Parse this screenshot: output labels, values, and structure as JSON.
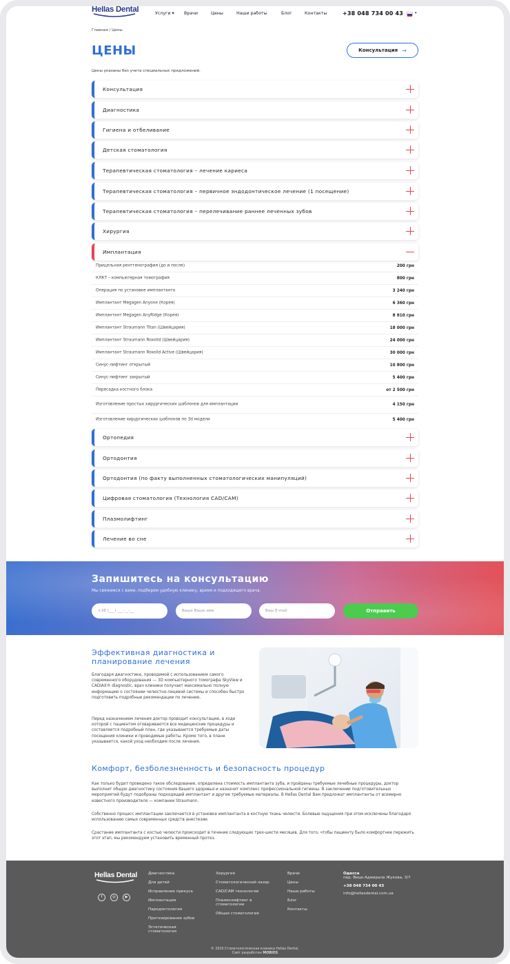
{
  "header": {
    "logo": "Hellas Dental",
    "nav": [
      {
        "label": "Услуги ▾"
      },
      {
        "label": "Врачи"
      },
      {
        "label": "Цены"
      },
      {
        "label": "Наши работы"
      },
      {
        "label": "Блог"
      },
      {
        "label": "Контакты"
      }
    ],
    "phone": "+38 048 734 00 43",
    "language": "RU"
  },
  "breadcrumb": "Главная  /  Цены",
  "page_title": "ЦЕНЫ",
  "consult_button": "Консультация",
  "note": "Цены указаны без учета специальных предложений.",
  "accordion": [
    {
      "label": "Консультация",
      "open": false
    },
    {
      "label": "Диагностика",
      "open": false
    },
    {
      "label": "Гигиена и отбеливание",
      "open": false
    },
    {
      "label": "Детская стоматология",
      "open": false
    },
    {
      "label": "Терапевтическая стоматология – лечение кариеса",
      "open": false
    },
    {
      "label": "Терапевтическая стоматология – первичное эндодонтическое лечение (1 посещение)",
      "open": false
    },
    {
      "label": "Терапевтическая стоматология – перелечивание раннее леченных зубов",
      "open": false
    },
    {
      "label": "Хирургия",
      "open": false
    },
    {
      "label": "Имплантация",
      "open": true
    },
    {
      "label": "Ортопедия",
      "open": false
    },
    {
      "label": "Ортодонтия",
      "open": false
    },
    {
      "label": "Ортодонтия (по факту выполненных стоматологических манипуляций)",
      "open": false
    },
    {
      "label": "Цифровая стоматология (Технология CAD/CAM)",
      "open": false
    },
    {
      "label": "Плазмолифтинг",
      "open": false
    },
    {
      "label": "Лечение во сне",
      "open": false
    }
  ],
  "implant_prices": [
    {
      "name": "Прицельная рентгенография (до и после)",
      "price": "200 грн"
    },
    {
      "name": "КЛКТ – компьютерная томография",
      "price": "800 грн"
    },
    {
      "name": "Операция по установке имплантанта",
      "price": "3 240 грн"
    },
    {
      "name": "Имплантант Megagen Anyone (Корея)",
      "price": "6 360 грн"
    },
    {
      "name": "Имплантант Megagen AnyRidge (Корея)",
      "price": "8 910 грн"
    },
    {
      "name": "Имплантант Straumann Titan (Швейцария)",
      "price": "18 000 грн"
    },
    {
      "name": "Имплантант Straumann Roxolid (Швейцария)",
      "price": "24 000 грн"
    },
    {
      "name": "Имплантант Straumann Roxolid Active (Швейцария)",
      "price": "30 000 грн"
    },
    {
      "name": "Синус-лифтинг открытый",
      "price": "10 800 грн"
    },
    {
      "name": "Синус-лифтинг закрытый",
      "price": "5 400 грн"
    },
    {
      "name": "Пересадка костного блока",
      "price": "от 2 500 грн"
    },
    {
      "name": "Изготовление простых хирургических шаблонов для имплантации",
      "price": "4 150 грн"
    },
    {
      "name": "Изготовление хирургических шаблонов по 3d модели",
      "price": "5 400 грн"
    }
  ],
  "form": {
    "title": "Запишитесь на консультацию",
    "subtitle": "Мы свяжемся с вами, подберем удобную клинику, время и подходящего врача.",
    "phone_placeholder": "+38 (___) ___-__-__",
    "name_placeholder": "Ваше Ваше имя",
    "email_placeholder": "Ваш  E-mail",
    "submit": "Отправить"
  },
  "article": {
    "h1": "Эффективная диагностика и планирование лечения",
    "p1": "Благодаря диагностике, проводимой с использованием самого современного оборудования — 3D компьютерного томографа SkyView и CADIAX® diagnostic, врач клиники получает максимально полную информацию о состоянии челюстно-лицевой системы и способен быстро подготовить подробные рекомендации по лечению.",
    "p2": "Перед назначением лечения доктор проводит консультацию, в ходе которой с пациентом оговариваются все медицинские процедуры и составляется подробный план, где указываются требуемые даты посещения клиники и проводимые работы. Кроме того, в плане указывается, какой уход необходим после лечения.",
    "h2": "Комфорт, безболезненность и безопасность процедур",
    "p3": "Как только будет проведено такое обследование, определена стоимость имплантанта зуба, и пройдены требуемые лечебные процедуры, доктор выполнит общую диагностику состояния Вашего здоровья и назначит комплекс профессиональной гигиены. В заключении подготовительных мероприятий будут подобраны подходящий имплантант и другие требуемые материалы. В Hellas Dental Вам предложат имплантанты от всемирно известного производителя — компании Straumann.",
    "p4": "Собственно процесс имплантации заключается в установке имплантанта в костную ткань челюсти. Болевые ощущения при этом исключены благодаря использованию самых современных средств анестезии.",
    "p5": "Срастание имплантанта с костью челюсти происходит в течение следующих трех-шести месяцев. Для того, чтобы пациенту было комфортнее пережить этот этап, мы рекомендуем установить временный протез."
  },
  "footer": {
    "logo": "Hellas Dental",
    "col1": [
      "Диагностика",
      "Для детей",
      "Исправление прикуса",
      "Имплантация",
      "Пародонтология",
      "Протезирование зубов",
      "Эстетическая стоматология"
    ],
    "col2": [
      "Хирургия",
      "Стоматологический лазер",
      "CAD/CAM технологии",
      "Плазмолифтинг в стоматологии",
      "Общая стоматология"
    ],
    "col3": [
      "Врачи",
      "Цены",
      "Наши работы",
      "Блог",
      "Контакты"
    ],
    "city": "Одесса",
    "address": "пер. Вице-Адмирала Жукова, 3/7",
    "phone": "+38 048 734 00 43",
    "email": "info@hellasdental.com.ua",
    "copyright": "© 2020 Стоматологическая клиника Hellas Dental.",
    "developer_prefix": "Сайт разработан",
    "developer": "MOBIOS"
  },
  "colors": {
    "accent_blue": "#2f6fd6",
    "accent_red": "#e8434f",
    "submit_green": "#4ccb4f",
    "footer_bg": "#5a5a5a"
  }
}
